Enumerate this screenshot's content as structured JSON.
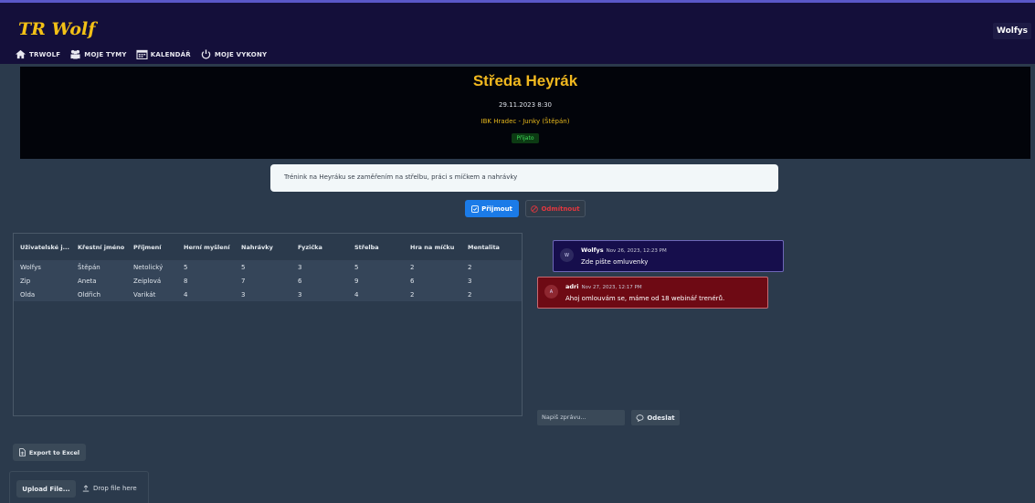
{
  "app": {
    "brand": "TR Wolf",
    "user": "Wolfys"
  },
  "nav": [
    {
      "label": "TRWOLF",
      "icon": "home-icon"
    },
    {
      "label": "MOJE TYMY",
      "icon": "team-icon"
    },
    {
      "label": "KALENDÁŘ",
      "icon": "calendar-icon"
    },
    {
      "label": "MOJE VYKONY",
      "icon": "fitness-icon"
    }
  ],
  "event": {
    "title": "Středa Heyrák",
    "date": "29.11.2023 8:30",
    "venue": "IBK Hradec - Junky (Štěpán)",
    "status": "Přijato"
  },
  "description": "Trénink na Heyráku se zaměřením na střelbu, práci s míčkem a nahrávky",
  "actions": {
    "accept": "Přijmout",
    "decline": "Odmítnout"
  },
  "table": {
    "headers": [
      "Uživatelské j...",
      "Křestní jméno",
      "Příjmení",
      "Herní myšlení",
      "Nahrávky",
      "Fyzička",
      "Střelba",
      "Hra na míčku",
      "Mentalita"
    ],
    "rows": [
      [
        "Wolfys",
        "Štěpán",
        "Netolický",
        "5",
        "5",
        "3",
        "5",
        "2",
        "2"
      ],
      [
        "Zip",
        "Aneta",
        "Zeiplová",
        "8",
        "7",
        "6",
        "9",
        "6",
        "3"
      ],
      [
        "Olda",
        "Oldřich",
        "Varikát",
        "4",
        "3",
        "3",
        "4",
        "2",
        "2"
      ]
    ]
  },
  "chat": {
    "messages": [
      {
        "author": "Wolfys",
        "time": "Nov 26, 2023, 12:23 PM",
        "text": "Zde pište omluvenky",
        "avatar": "W"
      },
      {
        "author": "adri",
        "time": "Nov 27, 2023, 12:17 PM",
        "text": "Ahoj omlouvám se, máme od 18 webinář trenérů.",
        "avatar": "A"
      }
    ],
    "placeholder": "Napiš zprávu...",
    "send": "Odeslat"
  },
  "export": "Export to Excel",
  "upload": {
    "button": "Upload File...",
    "drop": "Drop file here"
  },
  "colors": {
    "brand": "#f3c116",
    "accept": "#1b7be8",
    "decline": "#e2373f",
    "header": "#140f3a"
  }
}
